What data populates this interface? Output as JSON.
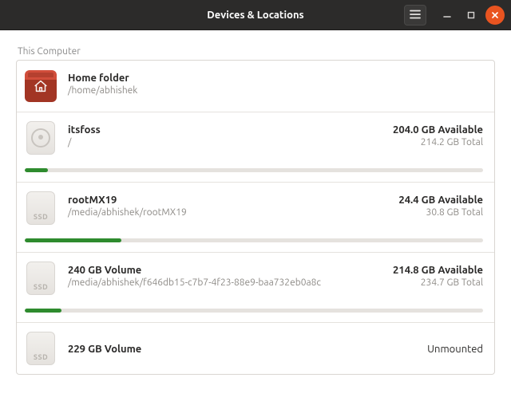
{
  "window": {
    "title": "Devices & Locations"
  },
  "section_label": "This Computer",
  "colors": {
    "accent": "#e95420",
    "bar_fill": "#2e8b2e"
  },
  "devices": [
    {
      "kind": "home",
      "name": "Home folder",
      "path": "/home/abhishek",
      "has_bar": false
    },
    {
      "kind": "hdd",
      "name": "itsfoss",
      "path": "/",
      "available": "204.0 GB Available",
      "total": "214.2 GB Total",
      "has_bar": true,
      "used_percent": 5
    },
    {
      "kind": "ssd",
      "ssd_text": "SSD",
      "name": "rootMX19",
      "path": "/media/abhishek/rootMX19",
      "available": "24.4 GB Available",
      "total": "30.8 GB Total",
      "has_bar": true,
      "used_percent": 21
    },
    {
      "kind": "ssd",
      "ssd_text": "SSD",
      "name": "240 GB Volume",
      "path": "/media/abhishek/f646db15-c7b7-4f23-88e9-baa732eb0a8c",
      "available": "214.8 GB Available",
      "total": "234.7 GB Total",
      "has_bar": true,
      "used_percent": 8
    },
    {
      "kind": "ssd",
      "ssd_text": "SSD",
      "name": "229 GB Volume",
      "path": "",
      "status": "Unmounted",
      "has_bar": false
    }
  ]
}
